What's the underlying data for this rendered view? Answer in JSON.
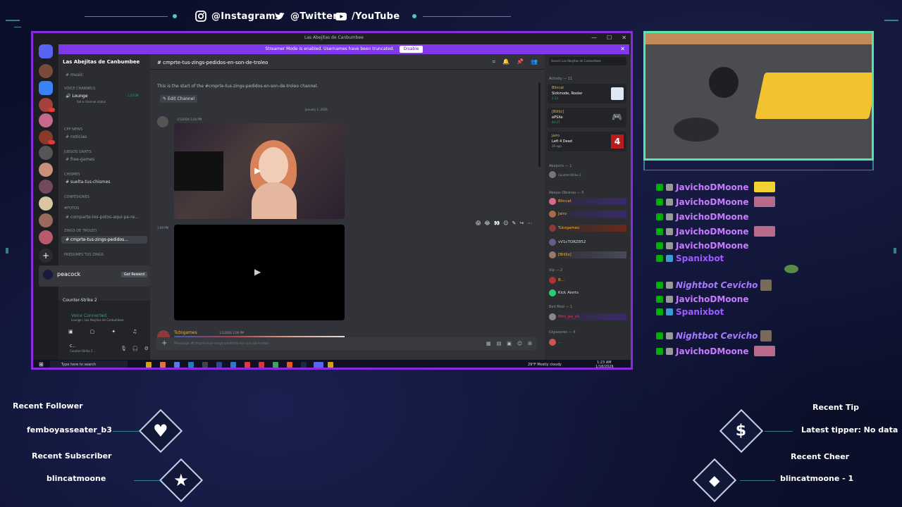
{
  "socials": [
    {
      "icon": "instagram-icon",
      "label": "@Instagram"
    },
    {
      "icon": "twitter-icon",
      "label": "@Twitter"
    },
    {
      "icon": "youtube-icon",
      "label": "/YouTube"
    }
  ],
  "window": {
    "title": "Las Abejitas de Canbumbee",
    "streamer_banner": "Streamer Mode is enabled. Usernames have been truncated.",
    "streamer_button": "Disable"
  },
  "discord": {
    "guild_name": "Las Abejitas de Canbumbee",
    "channel_header": "cmprte-tus-zings-pedidos-en-son-de-troleo",
    "search_placeholder": "Search Las Abejitas de Canbumbee",
    "channels": [
      {
        "type": "text",
        "label": "music"
      },
      {
        "type": "category",
        "label": "Voice Channels"
      },
      {
        "type": "voice",
        "label": "Lounge",
        "sub": "Set a channel status",
        "time": "1:23:59"
      },
      {
        "type": "category",
        "label": "CPP NEWS"
      },
      {
        "type": "text",
        "label": "noticias"
      },
      {
        "type": "category",
        "label": "Juegos Gratis"
      },
      {
        "type": "text",
        "label": "free-games"
      },
      {
        "type": "category",
        "label": "CHISMES"
      },
      {
        "type": "text",
        "label": "suelta-tus-chismes"
      },
      {
        "type": "category",
        "label": "CONFESIONES"
      },
      {
        "type": "category",
        "label": "#Fotos"
      },
      {
        "type": "text",
        "label": "comparte-los-potos-aqui-pa-re..."
      },
      {
        "type": "category",
        "label": "Zings De Troleo"
      },
      {
        "type": "text",
        "label": "cmprte-tus-zings-pedidos...",
        "selected": true
      },
      {
        "type": "category",
        "label": "Presumes Tus Zings"
      }
    ],
    "peacock": {
      "label": "peacock",
      "button": "Get Reward"
    },
    "game": "Counter-Strike 2",
    "voice": {
      "status": "Voice Connected",
      "where": "Lounge / Las Abejitas de Canbumbee"
    },
    "user": {
      "name": "C...",
      "status": "Counter-Strike 2 ..."
    },
    "chat": {
      "intro": "This is the start of the #cmprte-tus-zings-pedidos-en-son-de-troleo channel.",
      "edit": "Edit Channel",
      "date_divider": "January 1, 2026",
      "msg_time_1": "1/1/2026 1:04 PM",
      "msg_time_2": "1:06 PM",
      "author_2": "Tutogames",
      "msg_time_3": "1/1/2026 2:00 PM",
      "input_placeholder": "Message #cmprte-tus-zings-pedidos-en-son-de-troleo"
    },
    "activity_header": "Activity — 11",
    "activities": [
      {
        "name": "Blincat",
        "detail": "Sickmode, Rooler",
        "sub": "2:13"
      },
      {
        "name": "[Blililz]",
        "detail": "ePSXe",
        "sub": "44:27"
      },
      {
        "name": "Jairo",
        "detail": "Left 4 Dead",
        "sub": "26 ago"
      }
    ],
    "member_groups": [
      {
        "label": "Abejorro — 1",
        "members": [
          {
            "name": "...",
            "status": "Counter-Strike 2"
          }
        ]
      },
      {
        "label": "Abejas Obreras — 5",
        "members": [
          {
            "name": "Blincat",
            "status": "In voice"
          },
          {
            "name": "Jairo",
            "status": "In voice"
          },
          {
            "name": "Tutogames",
            "status": ""
          },
          {
            "name": "vV1cTORZ852",
            "status": ""
          },
          {
            "name": "[Blililz]",
            "status": "ePSXe"
          }
        ]
      },
      {
        "label": "Vip — 2",
        "members": [
          {
            "name": "B...",
            "status": "In voice"
          },
          {
            "name": "Kick Alerts",
            "status": ""
          }
        ]
      },
      {
        "label": "Bad Mod — 1",
        "members": [
          {
            "name": "Mini_pa_ch",
            "status": ""
          }
        ]
      },
      {
        "label": "Gigazanes — 4",
        "members": [
          {
            "name": "...",
            "status": ""
          }
        ]
      }
    ]
  },
  "taskbar": {
    "search": "Type here to search",
    "weather": "29°F  Mostly cloudy",
    "time": "1:23 AM",
    "date": "1/18/2026"
  },
  "twitch_chat": [
    {
      "user": "JavichoDMoone",
      "color": "#c77dff",
      "italic": false
    },
    {
      "user": "JavichoDMoone",
      "color": "#c77dff",
      "italic": false
    },
    {
      "user": "JavichoDMoone",
      "color": "#c77dff",
      "italic": false
    },
    {
      "user": "JavichoDMoone",
      "color": "#c77dff",
      "italic": false
    },
    {
      "user": "JavichoDMoone",
      "color": "#c77dff",
      "italic": false
    },
    {
      "user": "Spanixbot",
      "color": "#9d5cff",
      "italic": false
    },
    {
      "user": "Nightbot",
      "msg": "Cevicho",
      "color": "#a77bff",
      "italic": true
    },
    {
      "user": "JavichoDMoone",
      "color": "#c77dff",
      "italic": false
    },
    {
      "user": "Spanixbot",
      "color": "#9d5cff",
      "italic": false
    },
    {
      "user": "Nightbot",
      "msg": "Cevicho",
      "color": "#a77bff",
      "italic": true
    },
    {
      "user": "JavichoDMoone",
      "color": "#c77dff",
      "italic": false
    }
  ],
  "alerts": {
    "recent_follower_label": "Recent Follower",
    "recent_follower": "femboyasseater_b3",
    "recent_subscriber_label": "Recent Subscriber",
    "recent_subscriber": "blincatmoone",
    "recent_tip_label": "Recent Tip",
    "latest_tipper": "Latest tipper: No data",
    "recent_cheer_label": "Recent Cheer",
    "recent_cheer": "blincatmoone - 1"
  },
  "colors": {
    "accent_purple": "#8a2be2",
    "cam_border": "#58e6a8",
    "deco_cyan": "#4ec7c2",
    "discord_bg": "#313338"
  }
}
